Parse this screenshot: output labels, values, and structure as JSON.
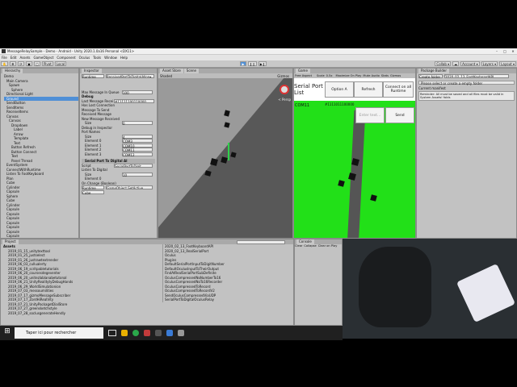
{
  "window": {
    "title": "MessageRelaySample - Demo - Android - Unity 2020.1.0a16 Personal <DX11>",
    "menu": [
      "File",
      "Edit",
      "Assets",
      "GameObject",
      "Component",
      "Oculus",
      "Tools",
      "Window",
      "Help"
    ]
  },
  "toolbar": {
    "play": "▶",
    "pause": "❙❙",
    "step": "▶❙",
    "collab": "Collab ▾",
    "account": "Account ▾",
    "layers": "Layers ▾",
    "layout": "Layout ▾"
  },
  "hierarchy": {
    "tab": "Hierarchy",
    "items": [
      "Demo",
      "Main Camera",
      "Spawn",
      "Sphere",
      "Directional Light",
      "Ground",
      "SendButton",
      "SendItems",
      "ReceiveItems",
      "Canvas",
      "Canvas",
      "Dropdown",
      "Label",
      "Arrow",
      "Template",
      "Text",
      "Button Refresh",
      "Button Connect",
      "Text",
      "Panel Thread",
      "EventSystem",
      "ConnectWithRuntime",
      "Listen To FootKeyboard",
      "Plan",
      "Cube",
      "Cylinder",
      "Capsule",
      "Sphere",
      "Cube",
      "Cylinder",
      "Capsule",
      "Capsule",
      "Capsule",
      "Capsule",
      "Capsule",
      "Capsule",
      "Capsule",
      "Capsule"
    ]
  },
  "inspector": {
    "tab": "Inspector",
    "runtime": "Runtime",
    "method": "ReceivedPortToDigitalAllon▾",
    "queue_label": "Max Message In Queue",
    "queue_value": "100",
    "debug_label": "Debug",
    "last_msg_label": "Last Message Recei",
    "last_msg_value": "#11111100110000",
    "has_lost": "Has Lost Connection",
    "to_send": "Message To Send",
    "received": "Received Message",
    "new_msg": "New Message Received",
    "size_label": "Size",
    "size_value": "0",
    "debug_port": "Debug in Inspector",
    "port_names": "Port Names",
    "size2": "4",
    "elements": [
      {
        "label": "Element 0",
        "value": "COM3"
      },
      {
        "label": "Element 1",
        "value": "COM10"
      },
      {
        "label": "Element 2",
        "value": "COM11"
      },
      {
        "label": "Element 3",
        "value": "COM12"
      }
    ],
    "component": "Serial Port To Digital Al",
    "script": "SerialPortToDigit",
    "listen": "Listen To Digital",
    "size3": "10",
    "element0": "Element 0",
    "on_change": "On Change (Boolean)",
    "runtime2": "Runtime",
    "game_object": "GameObject.SetActive",
    "cube": "Cube"
  },
  "scene": {
    "tabs": [
      "Asset Store",
      "Scene"
    ],
    "shaded": "Shaded",
    "gizmos": "Gizmos",
    "persp": "< Persp"
  },
  "game": {
    "tab": "Game",
    "aspect": "Free Aspect",
    "scale": "Scale",
    "scale_val": "0.5x",
    "maximize": "Maximize On Play",
    "mute": "Mute Audio",
    "stats": "Stats",
    "gizmos": "Gizmos",
    "title": "Serial Port List",
    "option": "Option A",
    "refresh": "Refresh",
    "connect": "Connect on all Runtime",
    "com": "COM11",
    "value": "#1111011100000",
    "placeholder": "Enter text...",
    "send": "Send"
  },
  "package": {
    "tab": "Package Builder",
    "create": "Create folder",
    "folder": "2020_02_13_FootKeyboardAPI",
    "hint": "Please select or create a empty folder",
    "current": "Current manifest",
    "warning": "Reminder: All must be saved and all files must be valid in System Assets! folds"
  },
  "project": {
    "tab": "Project",
    "search": "",
    "assets_label": "Assets",
    "folders": [
      "2019_01_15_unitytexttool",
      "2019_01_25_justselect",
      "2019_01_26_justrawtextrender",
      "2019_06_03_cullualerty",
      "2019_06_19_scritpabletutorials",
      "2019_06_20_coursesdegeventer",
      "2019_06_20_unitezlablanabetutonal",
      "2019_06_21_UnityRealitytyDebugHands",
      "2019_06_29_WorldSimulationion",
      "2019_07_03_messoumilities",
      "2019_07_17_gizmoMessageSubscriber",
      "2019_07_17_ZordHiRealVity",
      "2019_07_21_UnityPackagetDialStore",
      "2019_07_27_greensketchstyle",
      "2019_07_28_soclusgenerateHendly"
    ],
    "right_items": [
      "2020_02_13_FootKeyboardAPI",
      "2020_02_13_RealSerialPort",
      "Oculus",
      "Plugins",
      "DefaultSerialPortInputToDigitNumber",
      "DefaultOculusInputToTheirOutput",
      "FindAtRealSerialPortSubDefinite",
      "OculusCompressedNoNumberTo16",
      "OculusCompressedNoTo16Recorder",
      "OculusCompressedToRecord",
      "OculusCompressedToRecordV2",
      "SendOculusCompressedViaUDP",
      "SerialPortToDigitalOculusRelay"
    ]
  },
  "console": {
    "tab": "Console",
    "clear": "Clear",
    "collapse": "Collapse",
    "clear_play": "Clear on Play"
  },
  "taskbar": {
    "search": "Taper ici pour rechercher"
  }
}
